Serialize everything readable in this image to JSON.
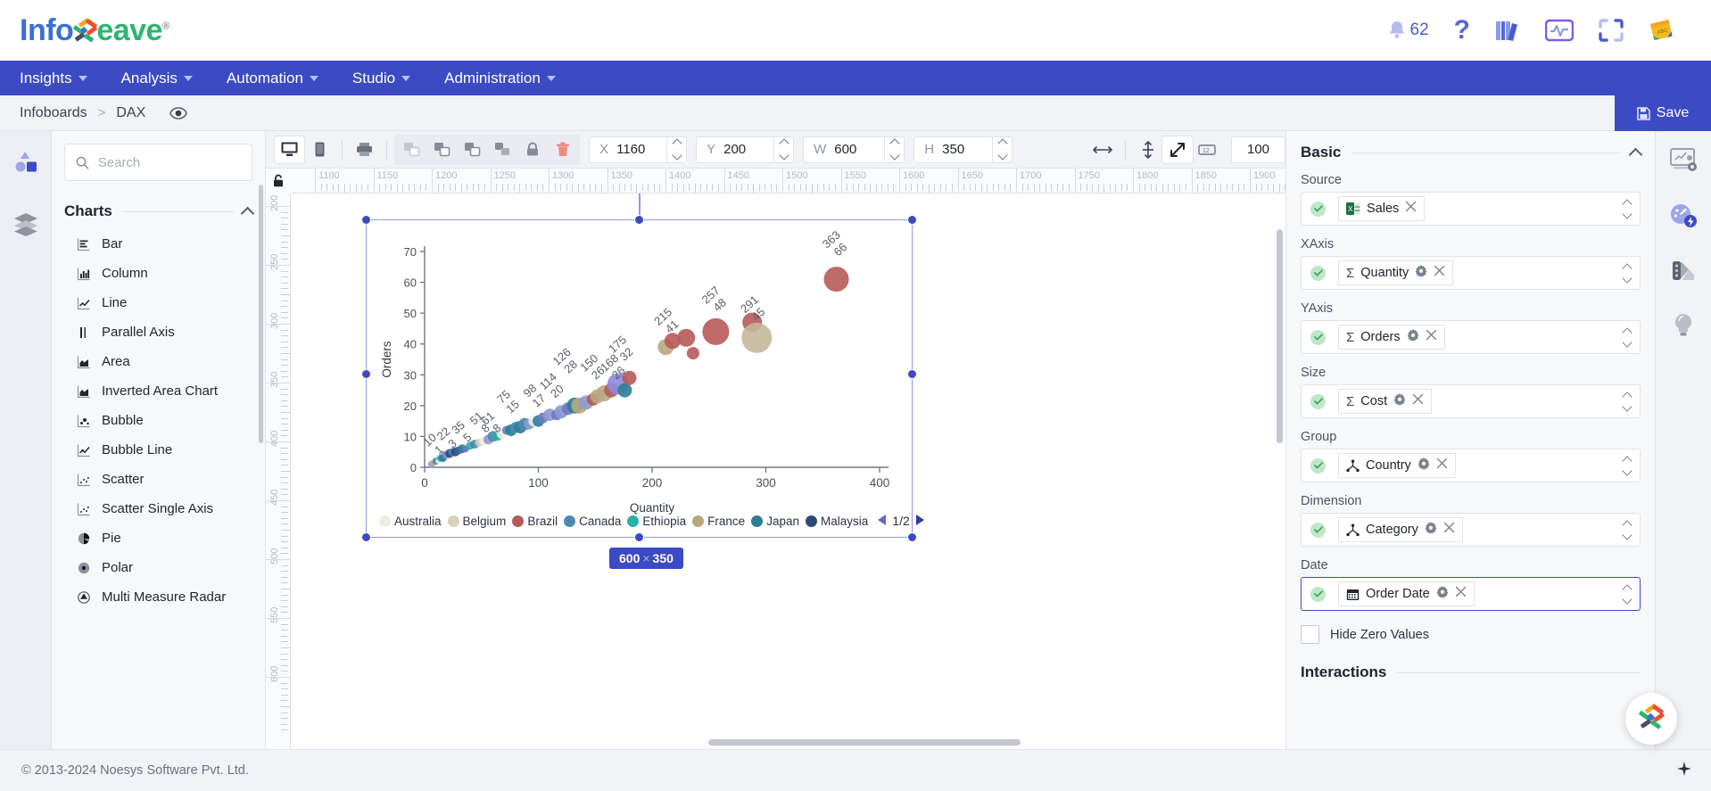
{
  "app": {
    "logo_info": "Info",
    "logo_eave": "eave",
    "logo_reg": "®"
  },
  "topbar": {
    "notification_count": "62",
    "icons": [
      "bell-icon",
      "help-icon",
      "library-icon",
      "monitor-activity-icon",
      "fullscreen-icon",
      "notes-icon"
    ]
  },
  "nav": {
    "items": [
      {
        "label": "Insights",
        "caret": true
      },
      {
        "label": "Analysis",
        "caret": true
      },
      {
        "label": "Automation",
        "caret": true
      },
      {
        "label": "Studio",
        "caret": true
      },
      {
        "label": "Administration",
        "caret": true
      }
    ]
  },
  "breadcrumb": {
    "items": [
      "Infoboards",
      "DAX"
    ],
    "separator": ">"
  },
  "save": {
    "label": "Save"
  },
  "left_panel": {
    "search_placeholder": "Search",
    "search_value": "",
    "section_title": "Charts",
    "items": [
      {
        "label": "Bar",
        "icon": "bar-chart-icon"
      },
      {
        "label": "Column",
        "icon": "column-chart-icon"
      },
      {
        "label": "Line",
        "icon": "line-chart-icon"
      },
      {
        "label": "Parallel Axis",
        "icon": "parallel-axis-icon"
      },
      {
        "label": "Area",
        "icon": "area-chart-icon"
      },
      {
        "label": "Inverted Area Chart",
        "icon": "inverted-area-chart-icon"
      },
      {
        "label": "Bubble",
        "icon": "bubble-chart-icon"
      },
      {
        "label": "Bubble Line",
        "icon": "bubble-line-chart-icon"
      },
      {
        "label": "Scatter",
        "icon": "scatter-chart-icon"
      },
      {
        "label": "Scatter Single Axis",
        "icon": "scatter-single-axis-icon"
      },
      {
        "label": "Pie",
        "icon": "pie-chart-icon"
      },
      {
        "label": "Polar",
        "icon": "polar-chart-icon"
      },
      {
        "label": "Multi Measure Radar",
        "icon": "radar-chart-icon"
      }
    ]
  },
  "toolbar": {
    "device_buttons": [
      "desktop-icon",
      "mobile-icon",
      "print-icon"
    ],
    "arrange_buttons": [
      "bring-forward-icon",
      "send-backward-icon",
      "bring-front-icon",
      "send-back-icon",
      "lock-icon",
      "delete-icon"
    ],
    "x": {
      "label": "X",
      "value": "1160"
    },
    "y": {
      "label": "Y",
      "value": "200"
    },
    "w": {
      "label": "W",
      "value": "600"
    },
    "h": {
      "label": "H",
      "value": "350"
    },
    "align_icons": [
      "align-horizontal-icon",
      "align-vertical-icon",
      "fit-icon",
      "grid-icon"
    ],
    "zoom_value": "100"
  },
  "canvas": {
    "size_badge": {
      "width": "600",
      "x": "×",
      "height": "350"
    },
    "ruler_h_labels": [
      "1100",
      "1150",
      "1200",
      "1250",
      "1300",
      "1350",
      "1400",
      "1450",
      "1500",
      "1550",
      "1600",
      "1650",
      "1700",
      "1750",
      "1800",
      "1850",
      "1900"
    ],
    "ruler_v_labels": [
      "200",
      "250",
      "300",
      "350",
      "400",
      "450",
      "500",
      "550",
      "600"
    ]
  },
  "chart_data": {
    "type": "scatter",
    "title": "",
    "xlabel": "Quantity",
    "ylabel": "Orders",
    "xlim": [
      0,
      400
    ],
    "ylim": [
      0,
      70
    ],
    "xticks": [
      0,
      100,
      200,
      300,
      400
    ],
    "yticks": [
      0,
      10,
      20,
      30,
      40,
      50,
      60,
      70
    ],
    "grid": false,
    "legend_position": "bottom",
    "legend": [
      {
        "name": "Australia",
        "color": "#efeee4"
      },
      {
        "name": "Belgium",
        "color": "#d8d3b8"
      },
      {
        "name": "Brazil",
        "color": "#b65a58"
      },
      {
        "name": "Canada",
        "color": "#4d8ab0"
      },
      {
        "name": "Ethiopia",
        "color": "#29b0a8"
      },
      {
        "name": "France",
        "color": "#b7a882"
      },
      {
        "name": "Japan",
        "color": "#2d7d96"
      },
      {
        "name": "Malaysia",
        "color": "#2e4a7d"
      }
    ],
    "legend_page": "1/2",
    "annotations": [
      {
        "x": 10,
        "y": 1
      },
      {
        "x": 22,
        "y": 3
      },
      {
        "x": 35,
        "y": 5
      },
      {
        "x": 51,
        "y": 8
      },
      {
        "x": 61,
        "y": 8
      },
      {
        "x": 75,
        "y": 15
      },
      {
        "x": 98,
        "y": 17
      },
      {
        "x": 114,
        "y": 20
      },
      {
        "x": 126,
        "y": 28
      },
      {
        "x": 150,
        "y": 26
      },
      {
        "x": 168,
        "y": 26
      },
      {
        "x": 175,
        "y": 32
      },
      {
        "x": 215,
        "y": 41
      },
      {
        "x": 257,
        "y": 48
      },
      {
        "x": 291,
        "y": 45
      },
      {
        "x": 363,
        "y": 66
      }
    ],
    "points": [
      {
        "x": 6,
        "y": 1,
        "r": 4,
        "c": "#9aa3c9"
      },
      {
        "x": 8,
        "y": 1.5,
        "r": 3.5,
        "c": "#b7a882"
      },
      {
        "x": 10,
        "y": 2,
        "r": 4,
        "c": "#4d8ab0"
      },
      {
        "x": 12,
        "y": 2,
        "r": 3,
        "c": "#efeee4"
      },
      {
        "x": 14,
        "y": 3,
        "r": 4,
        "c": "#29b0a8"
      },
      {
        "x": 16,
        "y": 3,
        "r": 4.5,
        "c": "#2d7d96"
      },
      {
        "x": 18,
        "y": 4,
        "r": 4,
        "c": "#6a7bbf"
      },
      {
        "x": 20,
        "y": 4,
        "r": 4,
        "c": "#8d9ad0"
      },
      {
        "x": 22,
        "y": 4.5,
        "r": 5,
        "c": "#2e4a7d"
      },
      {
        "x": 24,
        "y": 5,
        "r": 4,
        "c": "#4d8ab0"
      },
      {
        "x": 27,
        "y": 5,
        "r": 5,
        "c": "#2e4a7d"
      },
      {
        "x": 30,
        "y": 5.5,
        "r": 4.5,
        "c": "#3d5e92"
      },
      {
        "x": 33,
        "y": 6,
        "r": 5,
        "c": "#2d7d96"
      },
      {
        "x": 36,
        "y": 6,
        "r": 4,
        "c": "#6a7bbf"
      },
      {
        "x": 40,
        "y": 7,
        "r": 4.5,
        "c": "#29b0a8"
      },
      {
        "x": 44,
        "y": 7.5,
        "r": 5,
        "c": "#4d8ab0"
      },
      {
        "x": 48,
        "y": 8,
        "r": 4.5,
        "c": "#d8d3b8"
      },
      {
        "x": 52,
        "y": 8.5,
        "r": 5,
        "c": "#efeee4"
      },
      {
        "x": 56,
        "y": 9,
        "r": 5.5,
        "c": "#8d9ad0"
      },
      {
        "x": 60,
        "y": 10,
        "r": 6,
        "c": "#4d8ab0"
      },
      {
        "x": 64,
        "y": 10,
        "r": 5,
        "c": "#29b0a8"
      },
      {
        "x": 68,
        "y": 11,
        "r": 6,
        "c": "#efeee4"
      },
      {
        "x": 72,
        "y": 12,
        "r": 5,
        "c": "#6a7bbf"
      },
      {
        "x": 76,
        "y": 12,
        "r": 6.5,
        "c": "#2d7d96"
      },
      {
        "x": 80,
        "y": 13,
        "r": 6,
        "c": "#4d8ab0"
      },
      {
        "x": 84,
        "y": 13,
        "r": 7,
        "c": "#2d7d96"
      },
      {
        "x": 88,
        "y": 14,
        "r": 7,
        "c": "#4d8ab0"
      },
      {
        "x": 92,
        "y": 14,
        "r": 6,
        "c": "#8d9ad0"
      },
      {
        "x": 96,
        "y": 15,
        "r": 6,
        "c": "#efeee4"
      },
      {
        "x": 100,
        "y": 15,
        "r": 6.5,
        "c": "#2d7d96"
      },
      {
        "x": 104,
        "y": 16,
        "r": 6,
        "c": "#6a7bbf"
      },
      {
        "x": 110,
        "y": 17,
        "r": 7,
        "c": "#8d9ad0"
      },
      {
        "x": 116,
        "y": 17,
        "r": 6,
        "c": "#6a7bbf"
      },
      {
        "x": 120,
        "y": 18,
        "r": 7.5,
        "c": "#8d9ad0"
      },
      {
        "x": 126,
        "y": 19,
        "r": 7,
        "c": "#6a7bbf"
      },
      {
        "x": 132,
        "y": 20,
        "r": 9,
        "c": "#2d7d96"
      },
      {
        "x": 136,
        "y": 20,
        "r": 9,
        "c": "#b7a882"
      },
      {
        "x": 142,
        "y": 21,
        "r": 8,
        "c": "#8d9ad0"
      },
      {
        "x": 148,
        "y": 22,
        "r": 7,
        "c": "#b65a58"
      },
      {
        "x": 152,
        "y": 23,
        "r": 8,
        "c": "#b7a882"
      },
      {
        "x": 158,
        "y": 24,
        "r": 9,
        "c": "#b7a882"
      },
      {
        "x": 164,
        "y": 25,
        "r": 8,
        "c": "#b65a58"
      },
      {
        "x": 170,
        "y": 27,
        "r": 12,
        "c": "#8d8ade"
      },
      {
        "x": 176,
        "y": 25,
        "r": 8,
        "c": "#2d7d96"
      },
      {
        "x": 180,
        "y": 29,
        "r": 8,
        "c": "#b65a58"
      },
      {
        "x": 212,
        "y": 39,
        "r": 9,
        "c": "#b7a882"
      },
      {
        "x": 218,
        "y": 41,
        "r": 9,
        "c": "#b65a58"
      },
      {
        "x": 230,
        "y": 42,
        "r": 10,
        "c": "#b65a58"
      },
      {
        "x": 236,
        "y": 37,
        "r": 7,
        "c": "#b65a58"
      },
      {
        "x": 256,
        "y": 44,
        "r": 15,
        "c": "#b65a58"
      },
      {
        "x": 288,
        "y": 47,
        "r": 11,
        "c": "#b65a58"
      },
      {
        "x": 292,
        "y": 42,
        "r": 17,
        "c": "#c4b79a"
      },
      {
        "x": 362,
        "y": 61,
        "r": 14,
        "c": "#b65a58"
      }
    ]
  },
  "right_panel": {
    "section": "Basic",
    "fields": [
      {
        "label": "Source",
        "chip": "Sales",
        "icon": "excel-icon",
        "gear": false,
        "focused": false
      },
      {
        "label": "XAxis",
        "chip": "Quantity",
        "icon": "sigma-icon",
        "gear": true,
        "focused": false
      },
      {
        "label": "YAxis",
        "chip": "Orders",
        "icon": "sigma-icon",
        "gear": true,
        "focused": false
      },
      {
        "label": "Size",
        "chip": "Cost",
        "icon": "sigma-icon",
        "gear": true,
        "focused": false
      },
      {
        "label": "Group",
        "chip": "Country",
        "icon": "hierarchy-icon",
        "gear": true,
        "focused": false
      },
      {
        "label": "Dimension",
        "chip": "Category",
        "icon": "hierarchy-icon",
        "gear": true,
        "focused": false
      },
      {
        "label": "Date",
        "chip": "Order Date",
        "icon": "calendar-icon",
        "gear": true,
        "focused": true
      }
    ],
    "hide_zero_label": "Hide Zero Values",
    "hide_zero_checked": false,
    "next_section": "Interactions"
  },
  "right_rail": {
    "icons": [
      "chart-settings-icon",
      "gauge-boost-icon",
      "palette-icon",
      "bulb-icon"
    ]
  },
  "footer": {
    "copyright": "© 2013-2024 Noesys Software Pvt. Ltd."
  },
  "colors": {
    "brand_blue": "#3c4bc4",
    "nav_blue": "#3c4bc4",
    "accent_green": "#2bb673",
    "panel_bg": "#f7f8fa"
  }
}
